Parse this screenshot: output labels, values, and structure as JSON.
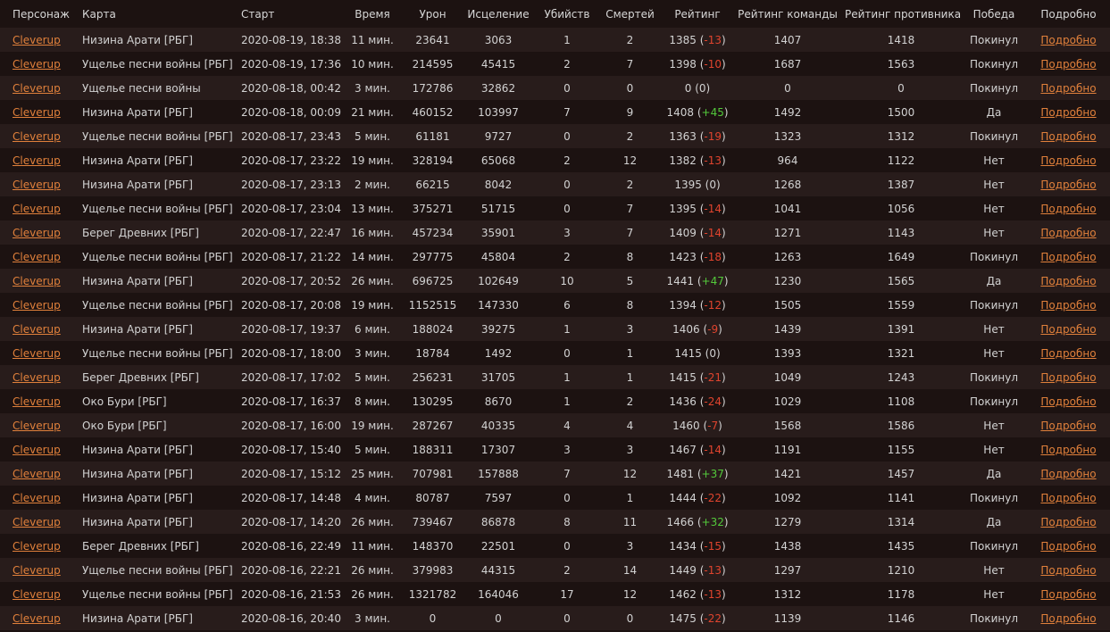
{
  "colors": {
    "background": "#1c1211",
    "row_alt": "#281c1b",
    "link": "#e0803b",
    "negative": "#e0442e",
    "positive": "#53c93b",
    "text": "#d2d2d2"
  },
  "table": {
    "headers": [
      "Персонаж",
      "Карта",
      "Старт",
      "Время",
      "Урон",
      "Исцеление",
      "Убийств",
      "Смертей",
      "Рейтинг",
      "Рейтинг команды",
      "Рейтинг противника",
      "Победа",
      "Подробно"
    ],
    "rows": [
      {
        "character": "Cleverup",
        "map": "Низина Арати [РБГ]",
        "start": "2020-08-19, 18:38",
        "time": "11 мин.",
        "damage": "23641",
        "healing": "3063",
        "kills": "1",
        "deaths": "2",
        "rating": "1385",
        "delta": "-13",
        "team_rating": "1407",
        "enemy_rating": "1418",
        "result": "Покинул",
        "details": "Подробно"
      },
      {
        "character": "Cleverup",
        "map": "Ущелье песни войны [РБГ]",
        "start": "2020-08-19, 17:36",
        "time": "10 мин.",
        "damage": "214595",
        "healing": "45415",
        "kills": "2",
        "deaths": "7",
        "rating": "1398",
        "delta": "-10",
        "team_rating": "1687",
        "enemy_rating": "1563",
        "result": "Покинул",
        "details": "Подробно"
      },
      {
        "character": "Cleverup",
        "map": "Ущелье песни войны",
        "start": "2020-08-18, 00:42",
        "time": "3 мин.",
        "damage": "172786",
        "healing": "32862",
        "kills": "0",
        "deaths": "0",
        "rating": "0",
        "delta": "0",
        "team_rating": "0",
        "enemy_rating": "0",
        "result": "Покинул",
        "details": "Подробно"
      },
      {
        "character": "Cleverup",
        "map": "Низина Арати [РБГ]",
        "start": "2020-08-18, 00:09",
        "time": "21 мин.",
        "damage": "460152",
        "healing": "103997",
        "kills": "7",
        "deaths": "9",
        "rating": "1408",
        "delta": "+45",
        "team_rating": "1492",
        "enemy_rating": "1500",
        "result": "Да",
        "details": "Подробно"
      },
      {
        "character": "Cleverup",
        "map": "Ущелье песни войны [РБГ]",
        "start": "2020-08-17, 23:43",
        "time": "5 мин.",
        "damage": "61181",
        "healing": "9727",
        "kills": "0",
        "deaths": "2",
        "rating": "1363",
        "delta": "-19",
        "team_rating": "1323",
        "enemy_rating": "1312",
        "result": "Покинул",
        "details": "Подробно"
      },
      {
        "character": "Cleverup",
        "map": "Низина Арати [РБГ]",
        "start": "2020-08-17, 23:22",
        "time": "19 мин.",
        "damage": "328194",
        "healing": "65068",
        "kills": "2",
        "deaths": "12",
        "rating": "1382",
        "delta": "-13",
        "team_rating": "964",
        "enemy_rating": "1122",
        "result": "Нет",
        "details": "Подробно"
      },
      {
        "character": "Cleverup",
        "map": "Низина Арати [РБГ]",
        "start": "2020-08-17, 23:13",
        "time": "2 мин.",
        "damage": "66215",
        "healing": "8042",
        "kills": "0",
        "deaths": "2",
        "rating": "1395",
        "delta": "0",
        "team_rating": "1268",
        "enemy_rating": "1387",
        "result": "Нет",
        "details": "Подробно"
      },
      {
        "character": "Cleverup",
        "map": "Ущелье песни войны [РБГ]",
        "start": "2020-08-17, 23:04",
        "time": "13 мин.",
        "damage": "375271",
        "healing": "51715",
        "kills": "0",
        "deaths": "7",
        "rating": "1395",
        "delta": "-14",
        "team_rating": "1041",
        "enemy_rating": "1056",
        "result": "Нет",
        "details": "Подробно"
      },
      {
        "character": "Cleverup",
        "map": "Берег Древних [РБГ]",
        "start": "2020-08-17, 22:47",
        "time": "16 мин.",
        "damage": "457234",
        "healing": "35901",
        "kills": "3",
        "deaths": "7",
        "rating": "1409",
        "delta": "-14",
        "team_rating": "1271",
        "enemy_rating": "1143",
        "result": "Нет",
        "details": "Подробно"
      },
      {
        "character": "Cleverup",
        "map": "Ущелье песни войны [РБГ]",
        "start": "2020-08-17, 21:22",
        "time": "14 мин.",
        "damage": "297775",
        "healing": "45804",
        "kills": "2",
        "deaths": "8",
        "rating": "1423",
        "delta": "-18",
        "team_rating": "1263",
        "enemy_rating": "1649",
        "result": "Покинул",
        "details": "Подробно"
      },
      {
        "character": "Cleverup",
        "map": "Низина Арати [РБГ]",
        "start": "2020-08-17, 20:52",
        "time": "26 мин.",
        "damage": "696725",
        "healing": "102649",
        "kills": "10",
        "deaths": "5",
        "rating": "1441",
        "delta": "+47",
        "team_rating": "1230",
        "enemy_rating": "1565",
        "result": "Да",
        "details": "Подробно"
      },
      {
        "character": "Cleverup",
        "map": "Ущелье песни войны [РБГ]",
        "start": "2020-08-17, 20:08",
        "time": "19 мин.",
        "damage": "1152515",
        "healing": "147330",
        "kills": "6",
        "deaths": "8",
        "rating": "1394",
        "delta": "-12",
        "team_rating": "1505",
        "enemy_rating": "1559",
        "result": "Покинул",
        "details": "Подробно"
      },
      {
        "character": "Cleverup",
        "map": "Низина Арати [РБГ]",
        "start": "2020-08-17, 19:37",
        "time": "6 мин.",
        "damage": "188024",
        "healing": "39275",
        "kills": "1",
        "deaths": "3",
        "rating": "1406",
        "delta": "-9",
        "team_rating": "1439",
        "enemy_rating": "1391",
        "result": "Нет",
        "details": "Подробно"
      },
      {
        "character": "Cleverup",
        "map": "Ущелье песни войны [РБГ]",
        "start": "2020-08-17, 18:00",
        "time": "3 мин.",
        "damage": "18784",
        "healing": "1492",
        "kills": "0",
        "deaths": "1",
        "rating": "1415",
        "delta": "0",
        "team_rating": "1393",
        "enemy_rating": "1321",
        "result": "Нет",
        "details": "Подробно"
      },
      {
        "character": "Cleverup",
        "map": "Берег Древних [РБГ]",
        "start": "2020-08-17, 17:02",
        "time": "5 мин.",
        "damage": "256231",
        "healing": "31705",
        "kills": "1",
        "deaths": "1",
        "rating": "1415",
        "delta": "-21",
        "team_rating": "1049",
        "enemy_rating": "1243",
        "result": "Покинул",
        "details": "Подробно"
      },
      {
        "character": "Cleverup",
        "map": "Око Бури [РБГ]",
        "start": "2020-08-17, 16:37",
        "time": "8 мин.",
        "damage": "130295",
        "healing": "8670",
        "kills": "1",
        "deaths": "2",
        "rating": "1436",
        "delta": "-24",
        "team_rating": "1029",
        "enemy_rating": "1108",
        "result": "Покинул",
        "details": "Подробно"
      },
      {
        "character": "Cleverup",
        "map": "Око Бури [РБГ]",
        "start": "2020-08-17, 16:00",
        "time": "19 мин.",
        "damage": "287267",
        "healing": "40335",
        "kills": "4",
        "deaths": "4",
        "rating": "1460",
        "delta": "-7",
        "team_rating": "1568",
        "enemy_rating": "1586",
        "result": "Нет",
        "details": "Подробно"
      },
      {
        "character": "Cleverup",
        "map": "Низина Арати [РБГ]",
        "start": "2020-08-17, 15:40",
        "time": "5 мин.",
        "damage": "188311",
        "healing": "17307",
        "kills": "3",
        "deaths": "3",
        "rating": "1467",
        "delta": "-14",
        "team_rating": "1191",
        "enemy_rating": "1155",
        "result": "Нет",
        "details": "Подробно"
      },
      {
        "character": "Cleverup",
        "map": "Низина Арати [РБГ]",
        "start": "2020-08-17, 15:12",
        "time": "25 мин.",
        "damage": "707981",
        "healing": "157888",
        "kills": "7",
        "deaths": "12",
        "rating": "1481",
        "delta": "+37",
        "team_rating": "1421",
        "enemy_rating": "1457",
        "result": "Да",
        "details": "Подробно"
      },
      {
        "character": "Cleverup",
        "map": "Низина Арати [РБГ]",
        "start": "2020-08-17, 14:48",
        "time": "4 мин.",
        "damage": "80787",
        "healing": "7597",
        "kills": "0",
        "deaths": "1",
        "rating": "1444",
        "delta": "-22",
        "team_rating": "1092",
        "enemy_rating": "1141",
        "result": "Покинул",
        "details": "Подробно"
      },
      {
        "character": "Cleverup",
        "map": "Низина Арати [РБГ]",
        "start": "2020-08-17, 14:20",
        "time": "26 мин.",
        "damage": "739467",
        "healing": "86878",
        "kills": "8",
        "deaths": "11",
        "rating": "1466",
        "delta": "+32",
        "team_rating": "1279",
        "enemy_rating": "1314",
        "result": "Да",
        "details": "Подробно"
      },
      {
        "character": "Cleverup",
        "map": "Берег Древних [РБГ]",
        "start": "2020-08-16, 22:49",
        "time": "11 мин.",
        "damage": "148370",
        "healing": "22501",
        "kills": "0",
        "deaths": "3",
        "rating": "1434",
        "delta": "-15",
        "team_rating": "1438",
        "enemy_rating": "1435",
        "result": "Покинул",
        "details": "Подробно"
      },
      {
        "character": "Cleverup",
        "map": "Ущелье песни войны [РБГ]",
        "start": "2020-08-16, 22:21",
        "time": "26 мин.",
        "damage": "379983",
        "healing": "44315",
        "kills": "2",
        "deaths": "14",
        "rating": "1449",
        "delta": "-13",
        "team_rating": "1297",
        "enemy_rating": "1210",
        "result": "Нет",
        "details": "Подробно"
      },
      {
        "character": "Cleverup",
        "map": "Ущелье песни войны [РБГ]",
        "start": "2020-08-16, 21:53",
        "time": "26 мин.",
        "damage": "1321782",
        "healing": "164046",
        "kills": "17",
        "deaths": "12",
        "rating": "1462",
        "delta": "-13",
        "team_rating": "1312",
        "enemy_rating": "1178",
        "result": "Нет",
        "details": "Подробно"
      },
      {
        "character": "Cleverup",
        "map": "Низина Арати [РБГ]",
        "start": "2020-08-16, 20:40",
        "time": "3 мин.",
        "damage": "0",
        "healing": "0",
        "kills": "0",
        "deaths": "0",
        "rating": "1475",
        "delta": "-22",
        "team_rating": "1139",
        "enemy_rating": "1146",
        "result": "Покинул",
        "details": "Подробно"
      }
    ]
  }
}
